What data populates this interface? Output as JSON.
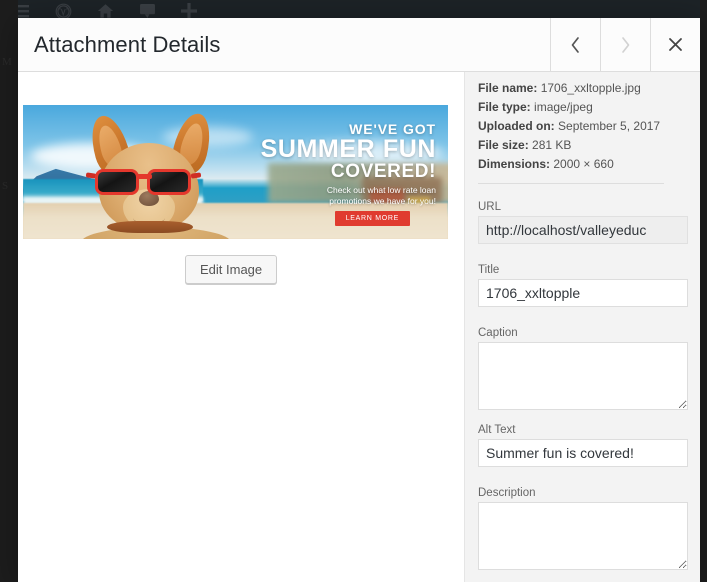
{
  "admin_bar": {
    "items": [
      {
        "name": "menu-icon",
        "glyph": "menu"
      },
      {
        "name": "wordpress-logo-icon",
        "glyph": "wordpress"
      },
      {
        "name": "site-home-icon",
        "glyph": "home"
      },
      {
        "name": "comments-icon",
        "glyph": "comment"
      },
      {
        "name": "new-content-icon",
        "glyph": "plus"
      }
    ]
  },
  "modal": {
    "title": "Attachment Details",
    "prev_label": "‹",
    "next_label": "›",
    "close_label": "×"
  },
  "attachment": {
    "edit_image_label": "Edit Image",
    "image_alt": "Summer fun is covered!",
    "banner": {
      "line1": "WE'VE GOT",
      "line2": "SUMMER FUN",
      "line3": "COVERED!",
      "subtext_line1": "Check out what low rate loan",
      "subtext_line2": "promotions we have for you!",
      "cta_label": "LEARN MORE"
    },
    "meta": {
      "file_name_label": "File name:",
      "file_name": "1706_xxltopple.jpg",
      "file_type_label": "File type:",
      "file_type": "image/jpeg",
      "uploaded_on_label": "Uploaded on:",
      "uploaded_on": "September 5, 2017",
      "file_size_label": "File size:",
      "file_size": "281 KB",
      "dimensions_label": "Dimensions:",
      "dimensions": "2000 × 660"
    },
    "fields": {
      "url_label": "URL",
      "url_value": "http://localhost/valleyeduc",
      "title_label": "Title",
      "title_value": "1706_xxltopple",
      "caption_label": "Caption",
      "caption_value": "",
      "alt_label": "Alt Text",
      "alt_value": "Summer fun is covered!",
      "description_label": "Description",
      "description_value": ""
    }
  },
  "colors": {
    "modal_bg": "#ffffff",
    "sidebar_bg": "#f3f3f3",
    "admin_bar_bg": "#1d2327",
    "backdrop": "#1d1d1d",
    "accent_red": "#e03b2f",
    "text_dark": "#23282d"
  }
}
